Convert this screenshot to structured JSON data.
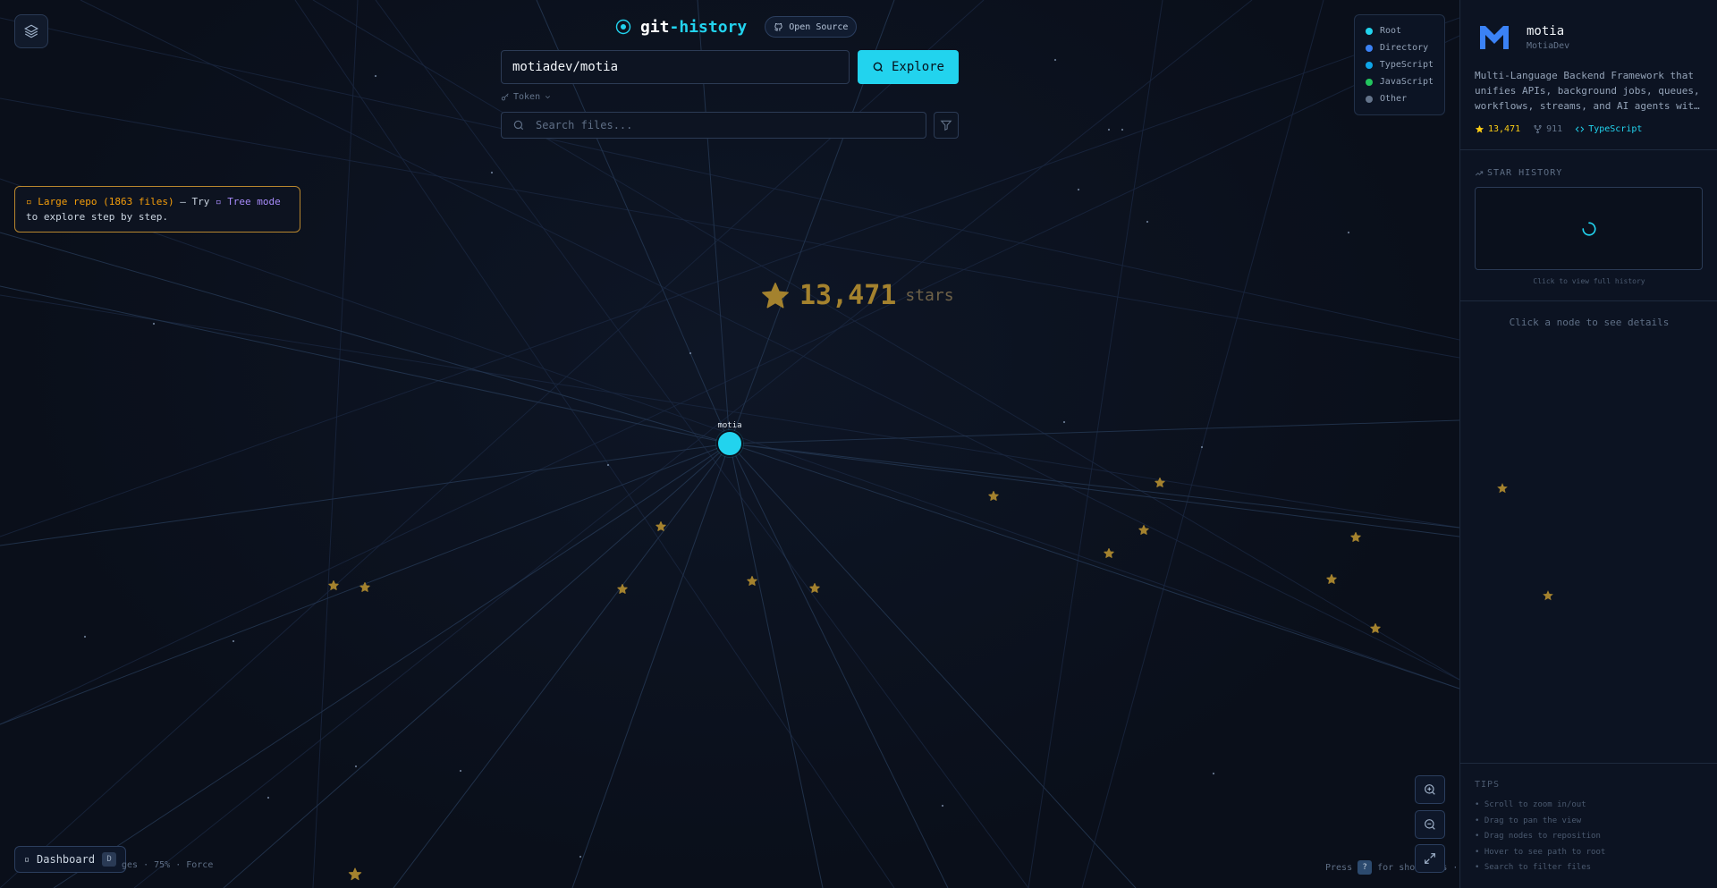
{
  "app": {
    "brand_main": "git",
    "brand_accent": "-history",
    "badge": "Open Source",
    "accent_color": "#22d3ee"
  },
  "search": {
    "repo_value": "motiadev/motia",
    "explore_label": "Explore",
    "token_label": "Token",
    "file_placeholder": "Search files..."
  },
  "legend": [
    {
      "label": "Root",
      "color": "#22d3ee"
    },
    {
      "label": "Directory",
      "color": "#3b82f6"
    },
    {
      "label": "TypeScript",
      "color": "#0ea5e9"
    },
    {
      "label": "JavaScript",
      "color": "#22c55e"
    },
    {
      "label": "Other",
      "color": "#64748b"
    }
  ],
  "notice": {
    "prefix": "Large repo (1863 files)",
    "middle": " — Try ",
    "tree_mode": "Tree mode",
    "suffix": "to explore step by step."
  },
  "graph": {
    "root_label": "motia",
    "stars_value": "13,471",
    "stars_unit": "stars"
  },
  "footer": {
    "dashboard_label": "Dashboard",
    "dashboard_key": "D",
    "status_text": "ges · 75% · Force",
    "shortcut_prefix": "Press",
    "shortcut_key": "?",
    "shortcut_suffix": "for shortcuts"
  },
  "panel": {
    "repo_name": "motia",
    "repo_owner": "MotiaDev",
    "description": "Multi-Language Backend Framework that unifies APIs, background jobs, queues, workflows, streams, and AI agents with a single core primitive",
    "stars": "13,471",
    "forks": "911",
    "language": "TypeScript",
    "star_history_label": "STAR HISTORY",
    "star_history_hint": "Click to view full history",
    "node_hint": "Click a node to see details",
    "tips_label": "TIPS",
    "tips": [
      "• Scroll to zoom in/out",
      "• Drag to pan the view",
      "• Drag nodes to reposition",
      "• Hover to see path to root",
      "• Search to filter files"
    ]
  }
}
